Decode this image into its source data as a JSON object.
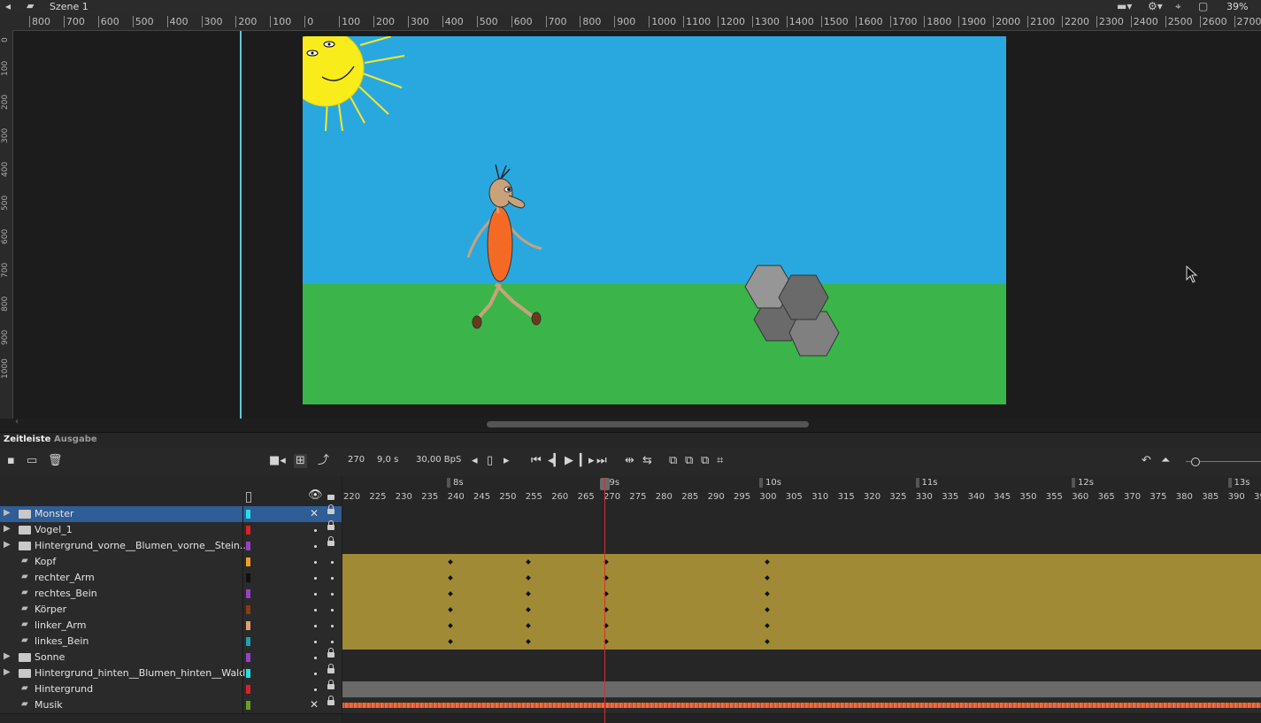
{
  "topbar": {
    "scene_name": "Szene 1",
    "zoom": "39%",
    "icons": [
      "back-arrow-icon",
      "clapper-icon",
      "scene-menu-icon",
      "symbol-edit-icon",
      "center-stage-icon",
      "clip-icon"
    ]
  },
  "hruler": [
    "800",
    "700",
    "600",
    "500",
    "400",
    "300",
    "200",
    "100",
    "0",
    "100",
    "200",
    "300",
    "400",
    "500",
    "600",
    "700",
    "800",
    "900",
    "1000",
    "1100",
    "1200",
    "1300",
    "1400",
    "1500",
    "1600",
    "1700",
    "1800",
    "1900",
    "2000",
    "2100",
    "2200",
    "2300",
    "2400",
    "2500",
    "2600",
    "2700"
  ],
  "vruler": [
    "0",
    "100",
    "200",
    "300",
    "400",
    "500",
    "600",
    "700",
    "800",
    "900",
    "1000"
  ],
  "tabs": {
    "timeline": "Zeitleiste",
    "output": "Ausgabe"
  },
  "toolbar": {
    "frame": "270",
    "time": "9,0 s",
    "fps": "30,00 BpS"
  },
  "frame_ruler": {
    "labels": [
      "220",
      "225",
      "230",
      "235",
      "240",
      "245",
      "250",
      "255",
      "260",
      "265",
      "270",
      "275",
      "280",
      "285",
      "290",
      "295",
      "300",
      "305",
      "310",
      "315",
      "320",
      "325",
      "330",
      "335",
      "340",
      "345",
      "350",
      "355",
      "360",
      "365",
      "370",
      "375",
      "380",
      "385",
      "390",
      "39"
    ],
    "seconds": [
      "8s",
      "9s",
      "10s",
      "11s",
      "12s",
      "13s"
    ]
  },
  "layers": [
    {
      "name": "Monster",
      "type": "folder",
      "color": "#22e0e8",
      "selected": true,
      "vis": "hidden",
      "lock": true
    },
    {
      "name": "Vogel_1",
      "type": "folder",
      "color": "#e02020",
      "vis": "dot",
      "lock": true
    },
    {
      "name": "Hintergrund_vorne__Blumen_vorne__Stein...",
      "type": "folder",
      "color": "#9a40c8",
      "vis": "dot",
      "lock": true
    },
    {
      "name": "Kopf",
      "type": "layer",
      "color": "#f2a020",
      "vis": "dot",
      "lock": false
    },
    {
      "name": "rechter_Arm",
      "type": "layer",
      "color": "#101010",
      "vis": "dot",
      "lock": false
    },
    {
      "name": "rechtes_Bein",
      "type": "layer",
      "color": "#9a40c8",
      "vis": "dot",
      "lock": false
    },
    {
      "name": "Körper",
      "type": "layer",
      "color": "#8a3a10",
      "vis": "dot",
      "lock": false
    },
    {
      "name": "linker_Arm",
      "type": "layer",
      "color": "#e0a070",
      "vis": "dot",
      "lock": false
    },
    {
      "name": "linkes_Bein",
      "type": "layer",
      "color": "#20a0b0",
      "vis": "dot",
      "lock": false
    },
    {
      "name": "Sonne",
      "type": "folder",
      "color": "#9a40c8",
      "vis": "dot",
      "lock": true
    },
    {
      "name": "Hintergrund_hinten__Blumen_hinten__Wald",
      "type": "folder",
      "color": "#22e0e8",
      "vis": "dot",
      "lock": true
    },
    {
      "name": "Hintergrund",
      "type": "layer",
      "color": "#e02020",
      "vis": "dot",
      "lock": true
    },
    {
      "name": "Musik",
      "type": "layer",
      "color": "#6aa020",
      "vis": "hidden",
      "lock": true
    }
  ],
  "keyframes": [
    240,
    255,
    270,
    301
  ],
  "colors": {
    "stage_sky": "#29a8e0",
    "stage_ground": "#3bb54a",
    "tween": "#a08a35",
    "playhead": "#d03030",
    "selection": "#2f5d96"
  }
}
